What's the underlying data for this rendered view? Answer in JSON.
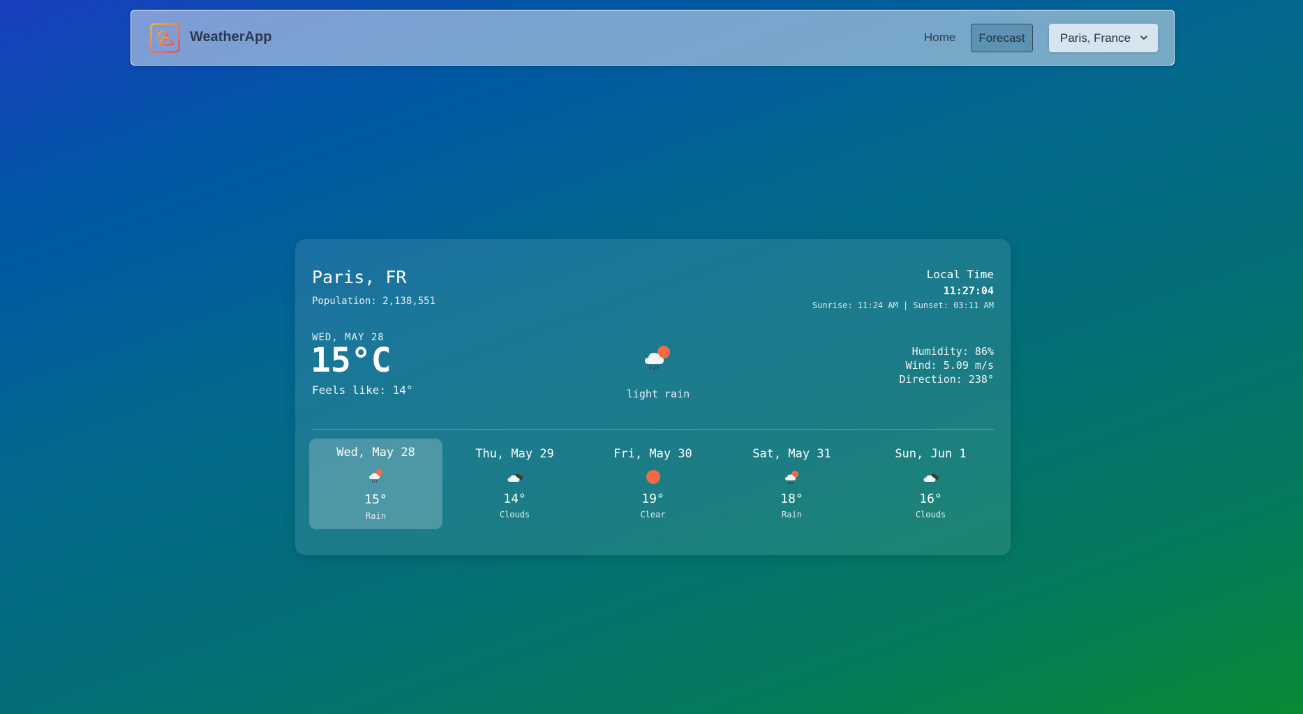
{
  "app": {
    "brand": "WeatherApp",
    "logo_icon": "sun-cloud-logo-icon"
  },
  "nav": {
    "home_label": "Home",
    "forecast_label": "Forecast",
    "city_selected": "Paris, France"
  },
  "current": {
    "city": "Paris, FR",
    "population": "Population: 2,138,551",
    "local_time_label": "Local Time",
    "local_time": "11:27:04",
    "sun_times": "Sunrise: 11:24 AM | Sunset: 03:11 AM",
    "date": "WED, MAY 28",
    "temperature": "15°C",
    "feels_like": "Feels like: 14°",
    "icon": "rain-sun-icon",
    "description": "light rain",
    "humidity": "Humidity: 86%",
    "wind": "Wind: 5.09 m/s",
    "direction": "Direction: 238°"
  },
  "forecast": [
    {
      "day": "Wed, May 28",
      "temp": "15°",
      "condition": "Rain",
      "icon": "rain-sun-icon",
      "active": true
    },
    {
      "day": "Thu, May 29",
      "temp": "14°",
      "condition": "Clouds",
      "icon": "clouds-icon",
      "active": false
    },
    {
      "day": "Fri, May 30",
      "temp": "19°",
      "condition": "Clear",
      "icon": "sun-icon",
      "active": false
    },
    {
      "day": "Sat, May 31",
      "temp": "18°",
      "condition": "Rain",
      "icon": "rain-sun-icon",
      "active": false
    },
    {
      "day": "Sun, Jun 1",
      "temp": "16°",
      "condition": "Clouds",
      "icon": "clouds-icon",
      "active": false
    }
  ],
  "colors": {
    "sun": "#f26b43",
    "cloud": "#f4f4f4",
    "cloud_dark": "#3a3a3a"
  }
}
